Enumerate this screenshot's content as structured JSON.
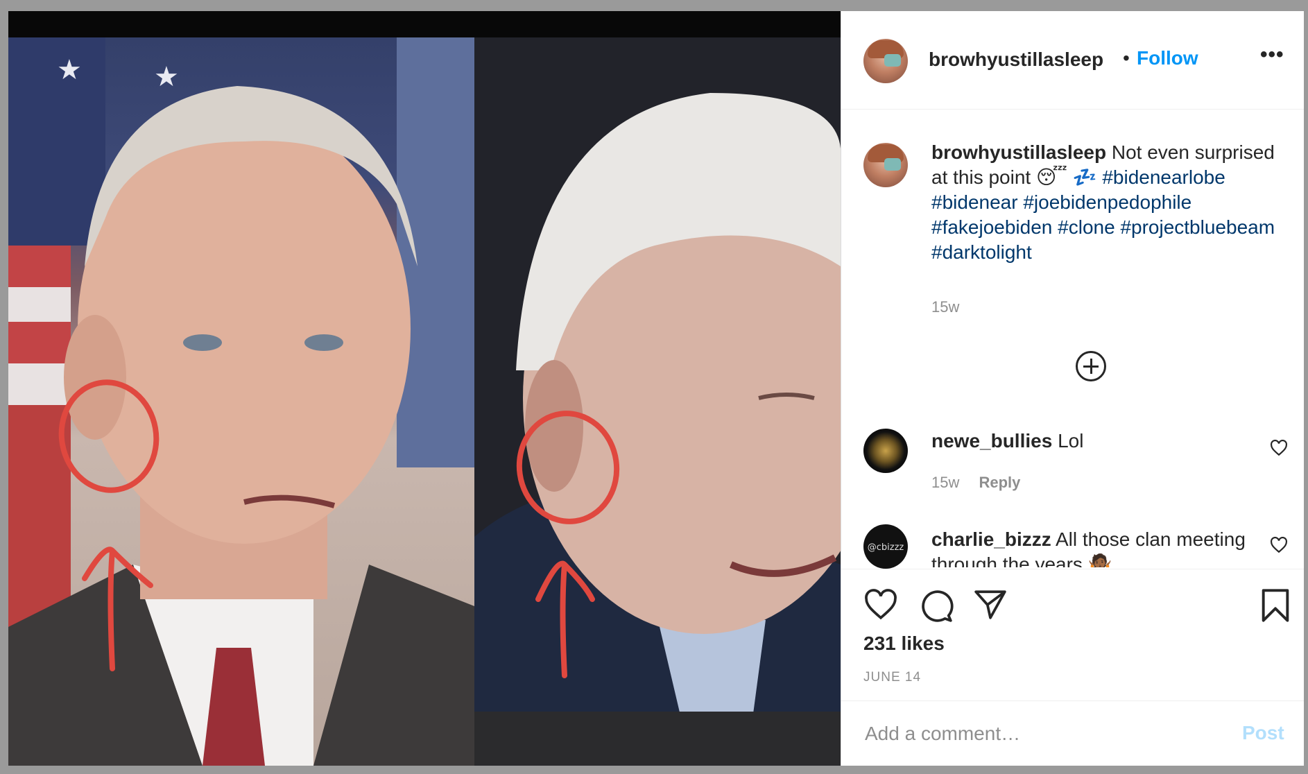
{
  "post": {
    "username": "browhyustillasleep",
    "follow_label": "Follow",
    "dot": "•",
    "more": "•••"
  },
  "caption": {
    "username": "browhyustillasleep",
    "text": "Not even surprised at this point 😴 💤",
    "hashtags": "#bidenearlobe #bidenear #joebidenpedophile #fakejoebiden #clone #projectbluebeam #darktolight",
    "time": "15w"
  },
  "comments": [
    {
      "username": "newe_bullies",
      "text": "Lol",
      "time": "15w",
      "reply_label": "Reply"
    },
    {
      "username": "charlie_bizzz",
      "text": "All those clan meeting through the years 🤷🏾",
      "avatar_text": "@cbizzz"
    }
  ],
  "actions": {
    "likes": "231 likes",
    "date": "JUNE 14"
  },
  "add_comment": {
    "placeholder": "Add a comment…",
    "post_label": "Post"
  },
  "colors": {
    "link_blue": "#0095f6",
    "hashtag_blue": "#00376b",
    "annotation_red": "#e0483f"
  }
}
